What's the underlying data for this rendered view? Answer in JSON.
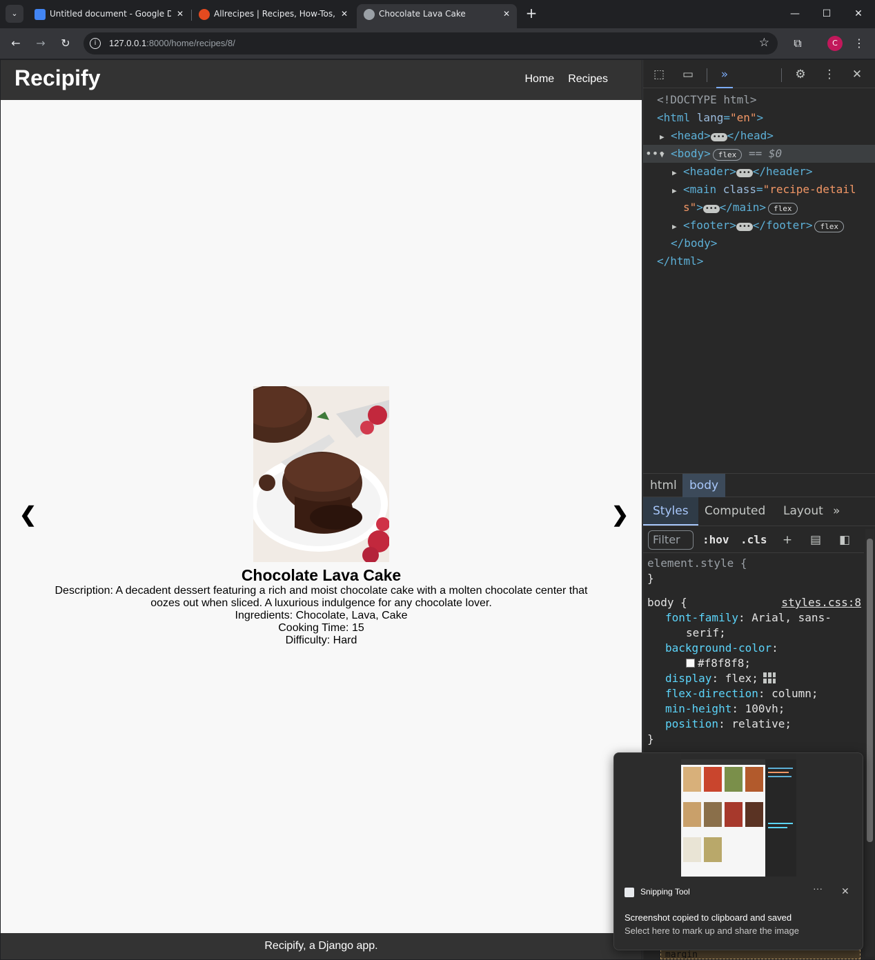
{
  "browser": {
    "tabs": [
      {
        "title": "Untitled document - Google Docs",
        "favicon": "google-docs-icon",
        "favicon_color": "#4285f4"
      },
      {
        "title": "Allrecipes | Recipes, How-Tos, Videos",
        "favicon": "allrecipes-icon",
        "favicon_color": "#e54a1f"
      },
      {
        "title": "Chocolate Lava Cake",
        "favicon": "globe-icon",
        "favicon_color": "#9aa0a6",
        "active": true
      }
    ],
    "url_host": "127.0.0.1",
    "url_rest": ":8000/home/recipes/8/",
    "profile_initial": "C",
    "profile_color": "#c2185b"
  },
  "site": {
    "logo": "Recipify",
    "nav": [
      "Home",
      "Recipes"
    ],
    "recipe": {
      "title": "Chocolate Lava Cake",
      "description": "Description: A decadent dessert featuring a rich and moist chocolate cake with a molten chocolate center that oozes out when sliced. A luxurious indulgence for any chocolate lover.",
      "ingredients": "Ingredients: Chocolate, Lava, Cake",
      "cooking_time": "Cooking Time: 15",
      "difficulty": "Difficulty: Hard"
    },
    "prev_arrow": "❮",
    "next_arrow": "❯",
    "footer": "Recipify, a Django app."
  },
  "devtools": {
    "dom": {
      "doctype": "<!DOCTYPE html>",
      "html_open_tag": "<html ",
      "html_lang_attr": "lang",
      "html_lang_val": "\"en\"",
      "head_open": "<head>",
      "head_close": "</head>",
      "body_tag": "<body>",
      "body_flex": "flex",
      "body_ref": "== $0",
      "header_open": "<header>",
      "header_close": "</header>",
      "main_open": "<main ",
      "main_attr": "class",
      "main_val_1": "\"recipe-detail",
      "main_val_2": "s\"",
      "main_close": "</main>",
      "main_flex": "flex",
      "footer_open": "<footer>",
      "footer_close": "</footer>",
      "footer_flex": "flex",
      "body_close": "</body>",
      "html_close": "</html>"
    },
    "breadcrumbs": [
      "html",
      "body"
    ],
    "panel_tabs": [
      "Styles",
      "Computed",
      "Layout"
    ],
    "filter_placeholder": "Filter",
    "hov": ":hov",
    "cls": ".cls",
    "styles": {
      "element_style": "element.style {",
      "close_brace": "}",
      "body_selector": "body {",
      "source": "styles.css:8",
      "font_family_prop": "font-family",
      "font_family_val_1": "Arial, sans-",
      "font_family_val_2": "serif;",
      "bg_prop": "background-color",
      "bg_val": "#f8f8f8;",
      "display_prop": "display",
      "display_val": "flex;",
      "flex_dir_prop": "flex-direction",
      "flex_dir_val": "column;",
      "min_h_prop": "min-height",
      "min_h_val": "100vh;",
      "position_prop": "position",
      "position_val": "relative;",
      "margin_label": "margin"
    }
  },
  "toast": {
    "app": "Snipping Tool",
    "title": "Screenshot copied to clipboard and saved",
    "subtitle": "Select here to mark up and share the image"
  }
}
